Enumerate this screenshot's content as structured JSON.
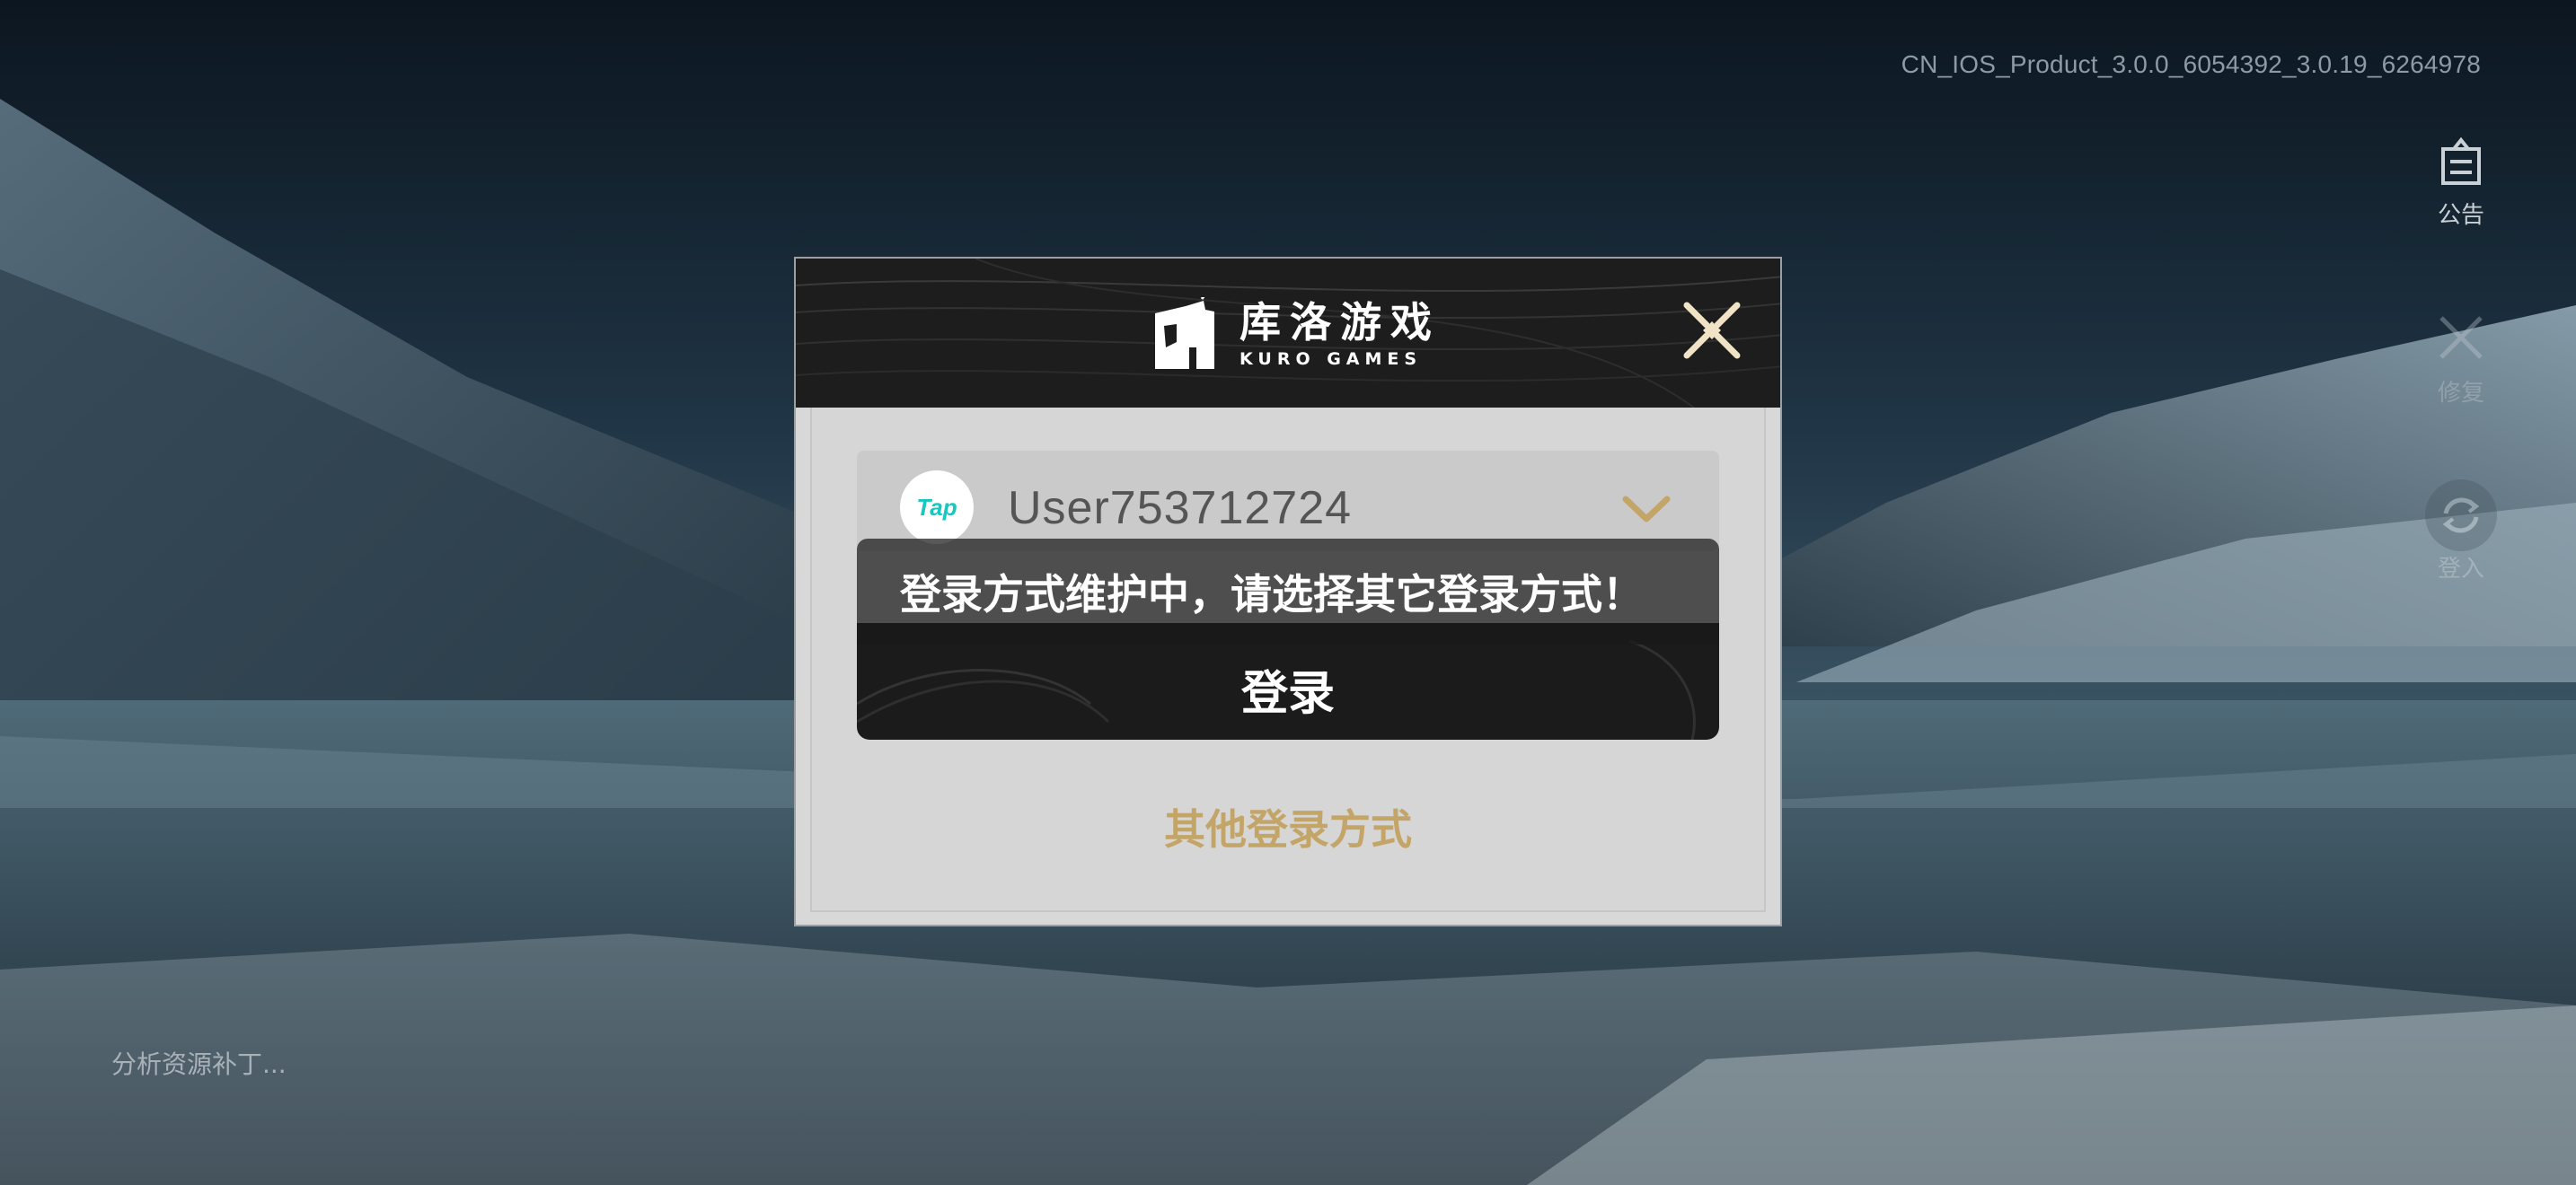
{
  "version": "CN_IOS_Product_3.0.0_6054392_3.0.19_6264978",
  "side_buttons": [
    {
      "label": "公告",
      "icon": "clipboard-icon"
    },
    {
      "label": "修复",
      "icon": "wrench-icon"
    },
    {
      "label": "登入",
      "icon": "refresh-icon"
    }
  ],
  "loading_text": "分析资源补丁...",
  "dialog": {
    "logo_cn": "库洛游戏",
    "logo_en": "KURO GAMES",
    "account": {
      "provider_badge": "Tap",
      "username": "User753712724"
    },
    "toast": "登录方式维护中，请选择其它登录方式！",
    "login_button": "登录",
    "other_login": "其他登录方式"
  },
  "colors": {
    "accent_gold": "#c4a568",
    "tap_teal": "#17c8c0",
    "header_dark": "#1d1d1d",
    "dialog_bg": "#d8d8d8"
  }
}
